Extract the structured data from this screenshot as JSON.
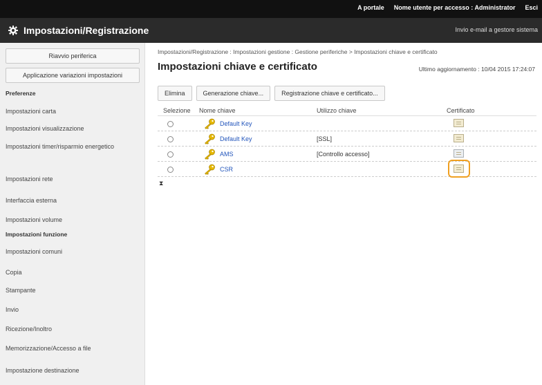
{
  "topbar": {
    "portal_label": "A portale",
    "user_label": "Nome utente per accesso :",
    "user_value": "Administrator",
    "logout_label": "Esci"
  },
  "titlebar": {
    "title": "Impostazioni/Registrazione",
    "mail_label": "Invio e-mail a gestore sistema"
  },
  "sidebar": {
    "restart_button": "Riavvio periferica",
    "apply_button": "Applicazione variazioni impostazioni",
    "sections": [
      {
        "label": "Preferenze",
        "items": [
          "Impostazioni carta",
          "Impostazioni visualizzazione",
          "Impostazioni timer/risparmio energetico",
          "Impostazioni rete",
          "Interfaccia esterna",
          "Impostazioni volume"
        ]
      },
      {
        "label": "Impostazioni funzione",
        "items": [
          "Impostazioni comuni",
          "Copia",
          "Stampante",
          "Invio",
          "Ricezione/Inoltro",
          "Memorizzazione/Accesso a file",
          "Impostazione destinazione"
        ]
      }
    ]
  },
  "main": {
    "breadcrumb": "Impostazioni/Registrazione : Impostazioni gestione : Gestione periferiche > Impostazioni chiave e certificato",
    "title": "Impostazioni chiave e certificato",
    "last_updated": "Ultimo aggiornamento : 10/04 2015 17:24:07",
    "toolbar": {
      "delete": "Elimina",
      "generate": "Generazione chiave...",
      "register": "Registrazione chiave e certificato..."
    },
    "table": {
      "headers": [
        "Selezione",
        "Nome chiave",
        "Utilizzo chiave",
        "Certificato"
      ],
      "rows": [
        {
          "name": "Default Key",
          "usage": "",
          "cert": "cert-icon"
        },
        {
          "name": "Default Key",
          "usage": "[SSL]",
          "cert": "cert-icon"
        },
        {
          "name": "AMS",
          "usage": "[Controllo accesso]",
          "cert": "cert-icon-grey"
        },
        {
          "name": "CSR",
          "usage": "",
          "cert": "cert-icon",
          "highlighted": true
        }
      ]
    },
    "scroll_top_glyph": "⧗"
  },
  "colors": {
    "topbar_bg": "#111111",
    "titlebar_bg": "#2b2b2b",
    "link": "#2255bb",
    "highlight": "#f0a020",
    "key": "#e6b800"
  }
}
